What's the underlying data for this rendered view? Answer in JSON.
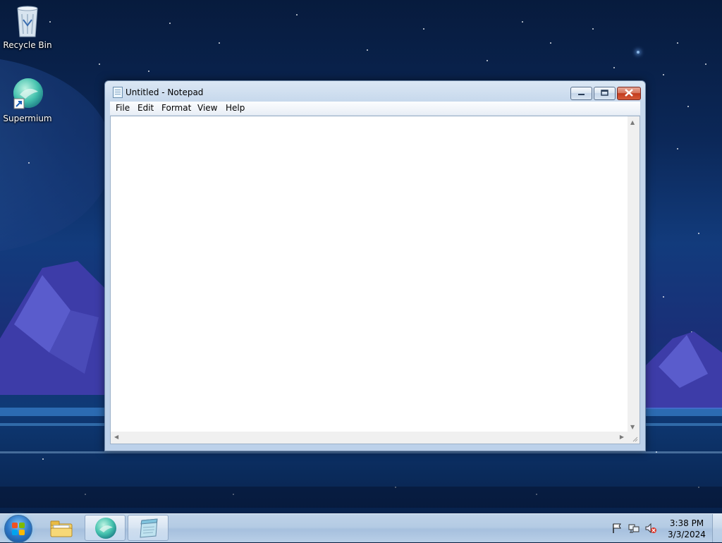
{
  "desktop": {
    "icons": [
      {
        "label": "Recycle Bin",
        "icon": "recycle-bin-icon"
      },
      {
        "label": "Supermium",
        "icon": "supermium-icon"
      }
    ]
  },
  "window": {
    "title": "Untitled - Notepad",
    "controls": {
      "minimize": "minimize-icon",
      "maximize": "restore-icon",
      "close": "close-icon"
    },
    "menu": [
      "File",
      "Edit",
      "Format",
      "View",
      "Help"
    ],
    "editor_text": ""
  },
  "taskbar": {
    "start": "windows-start-icon",
    "pinned": [
      {
        "name": "Windows Explorer",
        "icon": "folder-icon",
        "active": false
      },
      {
        "name": "Supermium",
        "icon": "supermium-icon",
        "active": true
      },
      {
        "name": "Notepad",
        "icon": "notepad-icon",
        "active": true
      }
    ],
    "tray": [
      "action-center-flag-icon",
      "network-icon",
      "volume-muted-icon"
    ],
    "clock": {
      "time": "3:38 PM",
      "date": "3/3/2024"
    }
  },
  "colors": {
    "desktop_top": "#071b3d",
    "desktop_mid": "#123b7c",
    "taskbar": "#b4cbe4",
    "close_button": "#c23b1e"
  }
}
